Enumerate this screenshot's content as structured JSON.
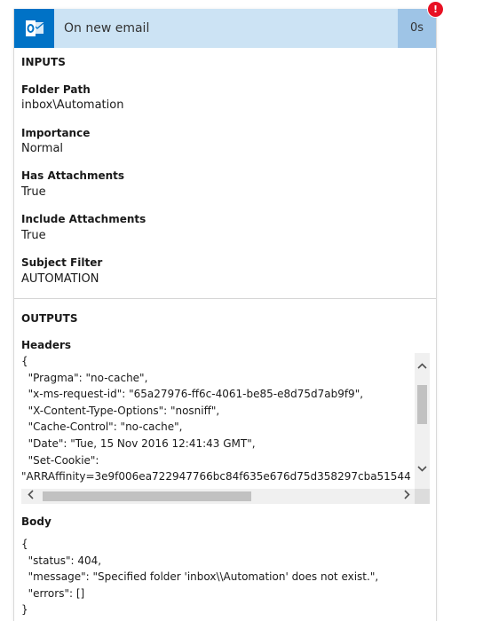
{
  "trigger": {
    "title": "On new email",
    "duration": "0s",
    "error_badge": "!"
  },
  "inputs": {
    "heading": "INPUTS",
    "fields": [
      {
        "label": "Folder Path",
        "value": "inbox\\Automation"
      },
      {
        "label": "Importance",
        "value": "Normal"
      },
      {
        "label": "Has Attachments",
        "value": "True"
      },
      {
        "label": "Include Attachments",
        "value": "True"
      },
      {
        "label": "Subject Filter",
        "value": "AUTOMATION"
      }
    ]
  },
  "outputs": {
    "heading": "OUTPUTS",
    "headers_label": "Headers",
    "headers_content": "{\n  \"Pragma\": \"no-cache\",\n  \"x-ms-request-id\": \"65a27976-ff6c-4061-be85-e8d75d7ab9f9\",\n  \"X-Content-Type-Options\": \"nosniff\",\n  \"Cache-Control\": \"no-cache\",\n  \"Date\": \"Tue, 15 Nov 2016 12:41:43 GMT\",\n  \"Set-Cookie\":\n\"ARRAffinity=3e9f006ea722947766bc84f635e676d75d358297cba51544",
    "body_label": "Body",
    "body_content": "{\n  \"status\": 404,\n  \"message\": \"Specified folder 'inbox\\\\Automation' does not exist.\",\n  \"errors\": []\n}"
  },
  "icons": {
    "app": "outlook-icon",
    "scroll_up": "chevron-up-icon",
    "scroll_down": "chevron-down-icon",
    "scroll_left": "chevron-left-icon",
    "scroll_right": "chevron-right-icon"
  },
  "colors": {
    "header_bg": "#cce3f4",
    "app_icon_bg": "#0072c6",
    "duration_bg": "#9ec4e6",
    "error": "#e81123"
  }
}
